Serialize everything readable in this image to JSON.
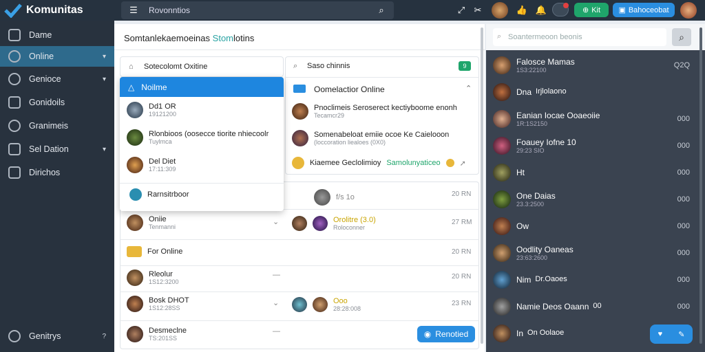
{
  "app": {
    "name": "Komunitas"
  },
  "topbar": {
    "search_placeholder": "Rovonntios",
    "kit_label": "Kit",
    "bb_label": "Bahoceobat"
  },
  "sidebar": {
    "items": [
      {
        "label": "Dame"
      },
      {
        "label": "Online"
      },
      {
        "label": "Genioce"
      },
      {
        "label": "Gonidoils"
      },
      {
        "label": "Granimeis"
      },
      {
        "label": "Sel Dation"
      },
      {
        "label": "Dirichos"
      }
    ],
    "bottom_label": "Genitrys"
  },
  "main": {
    "title": "Somtanlekaemoeinas",
    "title_accent": "Stom",
    "title_suffix": "lotins",
    "filter1_label": "Sotecolomt Oxitine",
    "filter2_label": "Saso chinnis",
    "filter2_badge": "9",
    "dropdown": {
      "header": "Noilme",
      "items": [
        {
          "name": "Dd1 OR",
          "sub": "19121200"
        },
        {
          "name": "Rlonbioos (oosecce tiorite nhiecoolr",
          "sub": "Tuylmca"
        },
        {
          "name": "Del Diet",
          "sub": "17:11:309"
        },
        {
          "name": "Rarnsitrboor",
          "sub": ""
        }
      ]
    },
    "panel_right": {
      "header": "Oomelactior Online",
      "items": [
        {
          "title": "Pnoclimeis Seroserect kectiyboome enonh",
          "sub": "Tecamcr29"
        },
        {
          "title": "Somenabeloat emiie ocoe Ke Caielooon",
          "sub": "(loccoration liealoes (0X0)"
        },
        {
          "title": "Kiaemee Geclolimioy",
          "accent": "Samolunyaticeo"
        }
      ]
    },
    "list": [
      {
        "name": "",
        "time": "20 RN",
        "mid": "f/s 1o"
      },
      {
        "name": "Oniie",
        "sub": "Tenmanni",
        "time": "27 RM",
        "mid": "Orolitre (3.0)",
        "mid_sub": "Roloconner"
      },
      {
        "name": "For Online",
        "sub": "",
        "time": "20 RN"
      },
      {
        "name": "Rleolur",
        "sub": "1S12:3200",
        "time": "20 RN"
      },
      {
        "name": "Bosk DHOT",
        "sub": "1S12:28SS",
        "time": "23 RN",
        "mid": "Ooo",
        "mid_sub": "28:28:008"
      },
      {
        "name": "Desmeclne",
        "sub": "TS:201SS",
        "time": ""
      }
    ],
    "bottom_button": "Renotied"
  },
  "right": {
    "search_placeholder": "Soantermeoon beonis",
    "items": [
      {
        "name": "Falosce Mamas",
        "sub": "1S3:22100",
        "tag": "Q2Q"
      },
      {
        "name": "Dna",
        "sub": "",
        "extra": "Irjlolaono",
        "tag": ""
      },
      {
        "name": "Eanian Iocae Ooaeoiie",
        "sub": "1R:1S2150",
        "tag": "000"
      },
      {
        "name": "Foauey Iofne 10",
        "sub": "29:23 SIO",
        "tag": "000"
      },
      {
        "name": "Ht",
        "sub": "",
        "tag": "000"
      },
      {
        "name": "One Daias",
        "sub": "23.3:2500",
        "tag": "000"
      },
      {
        "name": "Ow",
        "sub": "",
        "tag": "000"
      },
      {
        "name": "Oodlity Oaneas",
        "sub": "23:63:2600",
        "tag": "000"
      },
      {
        "name": "Nim",
        "sub": "",
        "extra": "Dr.Oaoes",
        "tag": "000"
      },
      {
        "name": "Namie Deos Oaann",
        "sub": "",
        "extra": "00",
        "tag": "000"
      },
      {
        "name": "In",
        "sub": "",
        "extra": "On Oolaoe",
        "tag": ""
      }
    ]
  },
  "colors": {
    "accent": "#2a8ee0",
    "sidebar": "#28323e",
    "active": "#2e6a8c",
    "green": "#1fa56b"
  }
}
